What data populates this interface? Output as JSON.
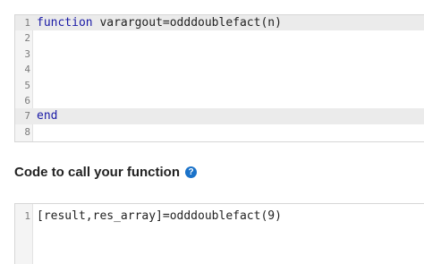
{
  "function_editor": {
    "lines": [
      {
        "num": "1",
        "keyword": "function",
        "text": " varargout=odddoublefact(n)"
      },
      {
        "num": "2",
        "keyword": "",
        "text": ""
      },
      {
        "num": "3",
        "keyword": "",
        "text": ""
      },
      {
        "num": "4",
        "keyword": "",
        "text": ""
      },
      {
        "num": "5",
        "keyword": "",
        "text": ""
      },
      {
        "num": "6",
        "keyword": "",
        "text": ""
      },
      {
        "num": "7",
        "keyword": "end",
        "text": ""
      },
      {
        "num": "8",
        "keyword": "",
        "text": ""
      }
    ]
  },
  "call_section": {
    "heading": "Code to call your function",
    "help_icon": "?"
  },
  "call_editor": {
    "lines": [
      {
        "num": "1",
        "text": "[result,res_array]=odddoublefact(9)"
      }
    ]
  },
  "colors": {
    "keyword": "#1a1aa6",
    "help_icon": "#1a72c9",
    "active_line": "#ebebeb"
  }
}
